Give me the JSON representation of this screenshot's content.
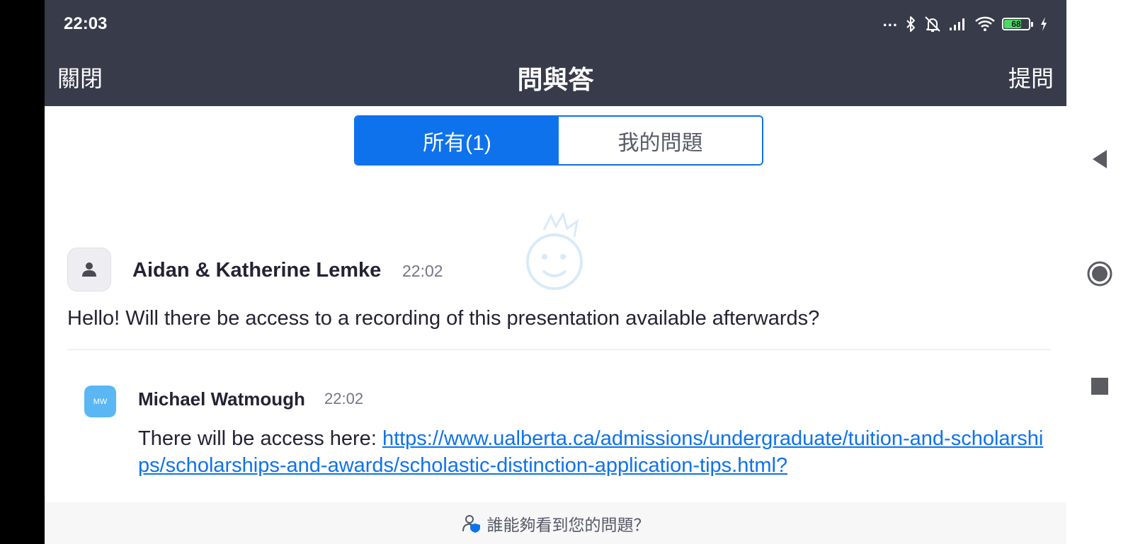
{
  "status_bar": {
    "time": "22:03",
    "dots": "...",
    "battery_level": "68",
    "icons": [
      "bluetooth-icon",
      "mute-icon",
      "signal-icon",
      "wifi-icon",
      "battery-icon",
      "charging-icon"
    ]
  },
  "header": {
    "close_label": "關閉",
    "title": "問與答",
    "ask_label": "提問"
  },
  "tabs": [
    {
      "label": "所有(1)",
      "active": true
    },
    {
      "label": "我的問題",
      "active": false
    }
  ],
  "question": {
    "author": "Aidan & Katherine Lemke",
    "time": "22:02",
    "text": "Hello!  Will there be access to a recording of this presentation available afterwards?"
  },
  "answer": {
    "avatar_initials": "MW",
    "author": "Michael Watmough",
    "time": "22:02",
    "text_prefix": "There will be access here: ",
    "link": "https://www.ualberta.ca/admissions/undergraduate/tuition-and-scholarships/scholarships-and-awards/scholastic-distinction-application-tips.html?"
  },
  "footer": {
    "text": "誰能夠看到您的問題？"
  },
  "colors": {
    "header_bg": "#383b4a",
    "accent": "#0e72ed",
    "answer_avatar": "#5ab7f4"
  },
  "android_nav": [
    "back-icon",
    "home-icon",
    "recents-icon"
  ]
}
